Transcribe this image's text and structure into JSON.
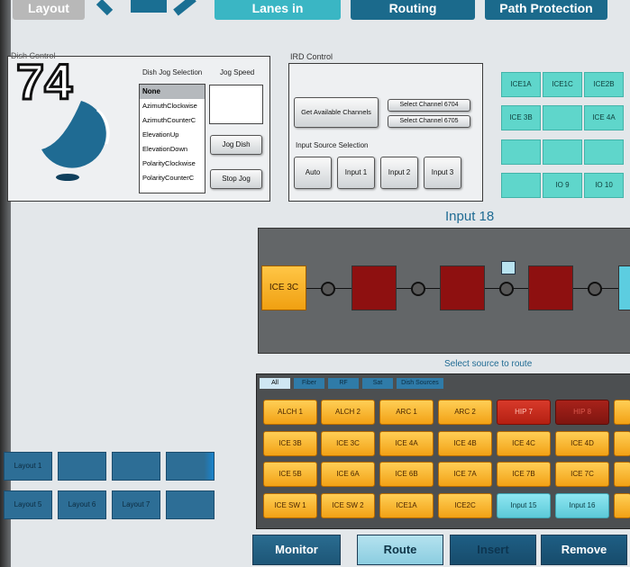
{
  "top_nav": [
    "Layout",
    "Lanes in",
    "Routing",
    "Path Protection"
  ],
  "dish": {
    "title": "Dish Control",
    "number": "74",
    "selection_label": "Dish Jog Selection",
    "options": [
      "None",
      "AzimuthClockwise",
      "AzimuthCounterC",
      "ElevationUp",
      "ElevationDown",
      "PolarityClockwise",
      "PolarityCounterC"
    ],
    "speed_label": "Jog Speed",
    "jog_button": "Jog Dish",
    "stop_button": "Stop Jog"
  },
  "ird": {
    "title": "IRD Control",
    "get_channels": "Get Available Channels",
    "ch1": "Select Channel 6704",
    "ch2": "Select Channel 6705",
    "input_source_label": "Input Source Selection",
    "inputs": [
      "Auto",
      "Input 1",
      "Input 2",
      "Input 3"
    ]
  },
  "tiles": [
    "ICE1A",
    "ICE1C",
    "ICE2B",
    "ICE 3B",
    "",
    "ICE 4A",
    "",
    "",
    "",
    "",
    "IO 9",
    "IO 10"
  ],
  "path": {
    "title": "Input 18",
    "source": "ICE 3C"
  },
  "source_select": {
    "title": "Select source to route",
    "filters": [
      "All",
      "Fiber",
      "RF",
      "Sat",
      "Dish Sources"
    ],
    "rows": [
      [
        "ALCH 1",
        "ALCH 2",
        "ARC 1",
        "ARC 2",
        "HIP 7",
        "HIP 8"
      ],
      [
        "ICE 3B",
        "ICE 3C",
        "ICE 4A",
        "ICE 4B",
        "ICE 4C",
        "ICE 4D"
      ],
      [
        "ICE 5B",
        "ICE 6A",
        "ICE 6B",
        "ICE 7A",
        "ICE 7B",
        "ICE 7C"
      ],
      [
        "ICE SW 1",
        "ICE SW 2",
        "ICE1A",
        "ICE2C",
        "Input 15",
        "Input 16"
      ]
    ]
  },
  "layouts": [
    "Layout 1",
    "",
    "",
    "",
    "Layout 5",
    "Layout 6",
    "Layout 7",
    ""
  ],
  "bottom_buttons": [
    "Monitor",
    "Route",
    "Insert",
    "Remove"
  ]
}
